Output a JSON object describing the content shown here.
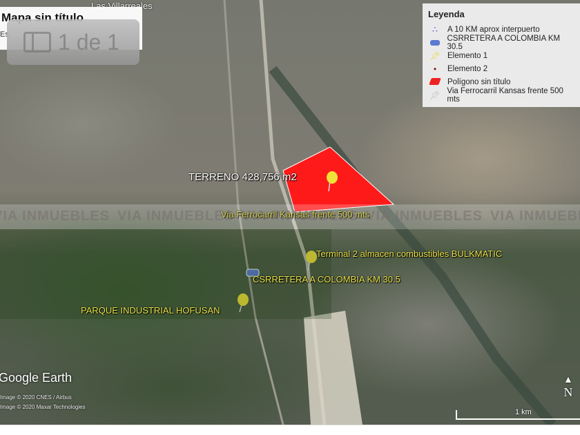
{
  "title_panel": {
    "title": "Mapa sin título",
    "subtitle": "Es"
  },
  "counter": {
    "text": "1 de 1",
    "icon": "slides-icon"
  },
  "place_label": "Las Villarreales",
  "legend": {
    "title": "Leyenda",
    "items": [
      {
        "label": "A 10 KM aprox interpuerto",
        "icon": "dots-cluster-icon",
        "color": "#3a3acc"
      },
      {
        "label": "CSRRETERA A COLOMBIA KM 30.5",
        "icon": "truck-icon",
        "color": "#5a7ad0"
      },
      {
        "label": "Elemento 1",
        "icon": "yellow-pushpin-icon",
        "color": "#e8e030"
      },
      {
        "label": "Elemento 2",
        "icon": "dot-icon",
        "color": "#7a1a1a"
      },
      {
        "label": "Polígono sin título",
        "icon": "red-polygon-icon",
        "color": "#ee2222"
      },
      {
        "label": "Via Ferrocarril Kansas frente 500 mts",
        "icon": "white-pushpin-icon",
        "color": "#dddddd"
      }
    ]
  },
  "map_labels": {
    "terreno": "TERRENO 428,756 m2",
    "ferrocarril": "Via Ferrocarril Kansas frente 500 mts",
    "terminal": "Terminal 2 almacen combustibles BULKMATIC",
    "carretera": "CSRRETERA A COLOMBIA KM 30.5",
    "parque": "PARQUE INDUSTRIAL HOFUSAN"
  },
  "watermark": "VIA INMUEBLES",
  "polygon_color": "#ff1a1a",
  "brand": "Google Earth",
  "copyright": [
    "Image © 2020 CNES / Airbus",
    "Image © 2020 Maxar Technologies"
  ],
  "scale_label": "1 km",
  "north_label": "N"
}
